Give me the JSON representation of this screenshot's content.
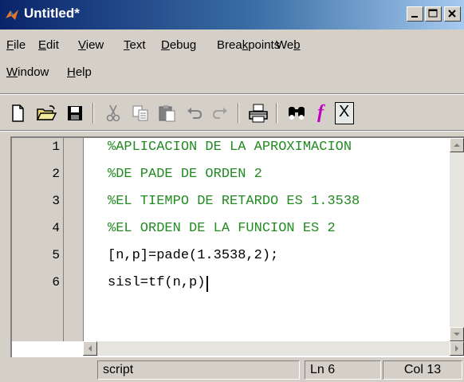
{
  "window": {
    "title": "Untitled*"
  },
  "menu": [
    {
      "label": "File",
      "mnemonic_index": 0
    },
    {
      "label": "Edit",
      "mnemonic_index": 0
    },
    {
      "label": "View",
      "mnemonic_index": 0
    },
    {
      "label": "Text",
      "mnemonic_index": 0
    },
    {
      "label": "Debug",
      "mnemonic_index": 0
    },
    {
      "label": "Breakpoints",
      "mnemonic_index": 4
    },
    {
      "label": "Web",
      "mnemonic_index": 2
    },
    {
      "label": "Window",
      "mnemonic_index": 0
    },
    {
      "label": "Help",
      "mnemonic_index": 0
    }
  ],
  "toolbar": {
    "icons": [
      "new-file-icon",
      "open-folder-icon",
      "save-icon",
      "cut-icon",
      "copy-icon",
      "paste-icon",
      "undo-icon",
      "redo-icon",
      "print-icon",
      "find-icon",
      "function-icon",
      "close-icon"
    ],
    "function_glyph": "f",
    "close_glyph": "X"
  },
  "editor": {
    "lines": [
      {
        "num": "1",
        "text": "%APLICACION DE LA APROXIMACION",
        "kind": "comment"
      },
      {
        "num": "2",
        "text": "%DE PADE DE ORDEN 2",
        "kind": "comment"
      },
      {
        "num": "3",
        "text": "%EL TIEMPO DE RETARDO ES 1.3538",
        "kind": "comment"
      },
      {
        "num": "4",
        "text": "%EL ORDEN DE LA FUNCION ES 2",
        "kind": "comment"
      },
      {
        "num": "5",
        "text": "[n,p]=pade(1.3538,2);",
        "kind": "code"
      },
      {
        "num": "6",
        "text": "sisl=tf(n,p)",
        "kind": "code"
      }
    ]
  },
  "status": {
    "mode": "script",
    "line": "Ln 6",
    "col": "Col 13"
  },
  "colors": {
    "comment": "#228b22",
    "title_bar": "#0a246a",
    "chrome": "#d4d0c8"
  }
}
